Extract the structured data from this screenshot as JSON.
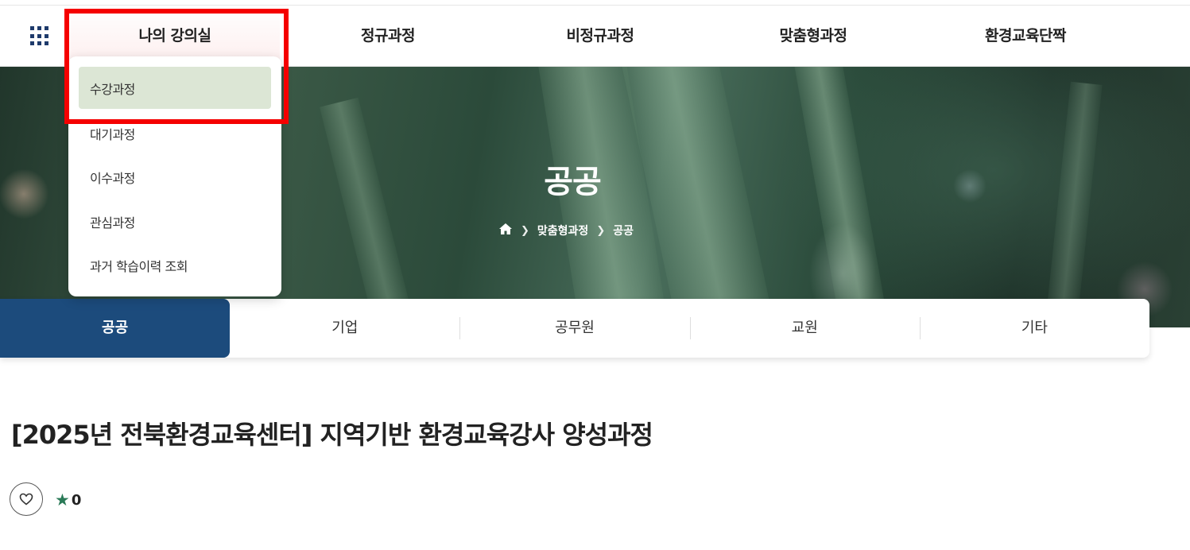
{
  "nav": {
    "items": [
      "나의 강의실",
      "정규과정",
      "비정규과정",
      "맞춤형과정",
      "환경교육단짝"
    ]
  },
  "dropdown": {
    "items": [
      "수강과정",
      "대기과정",
      "이수과정",
      "관심과정",
      "과거 학습이력 조회"
    ],
    "highlighted": "수강과정"
  },
  "hero": {
    "title": "공공",
    "breadcrumb": [
      "맞춤형과정",
      "공공"
    ]
  },
  "tabs": {
    "items": [
      "공공",
      "기업",
      "공무원",
      "교원",
      "기타"
    ],
    "selected": "공공"
  },
  "course": {
    "title": "[2025년 전북환경교육센터] 지역기반 환경교육강사 양성과정",
    "rating": "0"
  },
  "colors": {
    "primary": "#1c4b7c",
    "highlight": "#dce6d5",
    "star": "#2a7a57",
    "annotation": "#f50000"
  },
  "icons": {
    "menu": "grid-menu-icon",
    "home": "home-icon",
    "like": "heart-icon",
    "rating": "star-icon"
  }
}
